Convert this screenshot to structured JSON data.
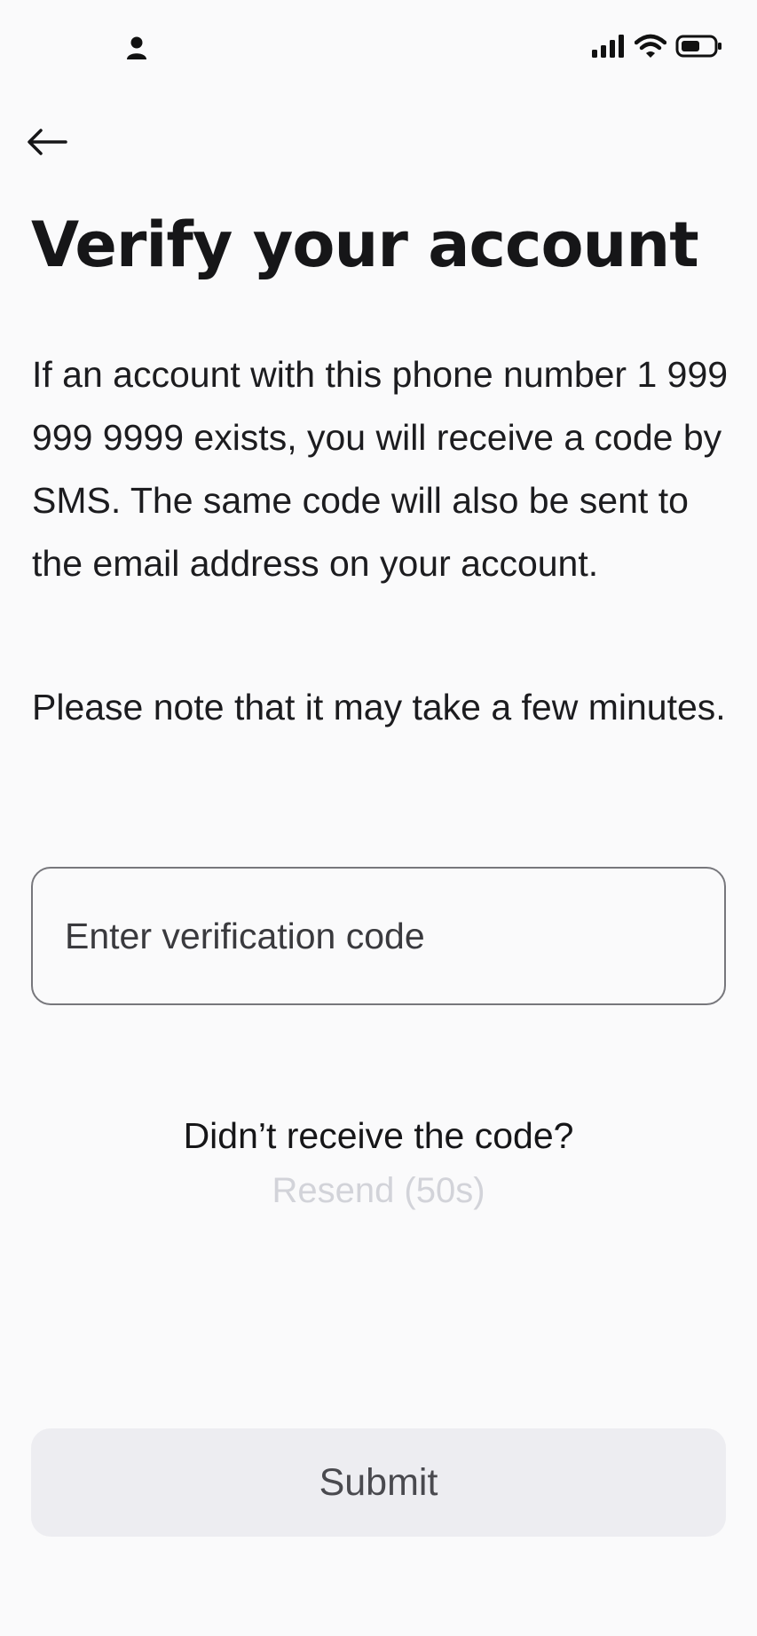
{
  "status_bar": {
    "left_icon": "person-icon",
    "right_icons": [
      "signal-bars-icon",
      "wifi-icon",
      "battery-icon"
    ]
  },
  "navigation": {
    "back_icon": "arrow-left-icon"
  },
  "page": {
    "title": "Verify your account",
    "description": "If an account with this phone number 1 999 999 9999 exists, you will receive a code by SMS. The same code will also be sent to the email address on your account.",
    "note": "Please note that it may take a few minutes."
  },
  "verification": {
    "placeholder": "Enter verification code",
    "value": ""
  },
  "resend": {
    "prompt": "Didn’t receive the code?",
    "link_label": "Resend (50s)"
  },
  "submit": {
    "label": "Submit"
  },
  "colors": {
    "background": "#fafafb",
    "text": "#161618",
    "field_border": "#77777c",
    "disabled_link": "#d2d3d9",
    "submit_background": "#ededf1",
    "submit_text": "#4a4a4f"
  }
}
